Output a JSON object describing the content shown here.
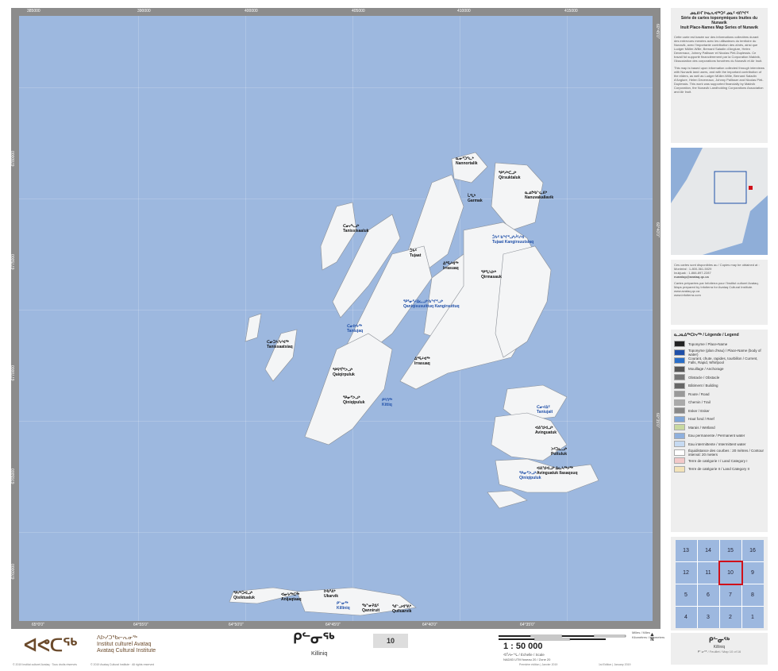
{
  "map": {
    "coords_top": [
      "385000",
      "390000",
      "400000",
      "405000",
      "410000",
      "415000"
    ],
    "coords_bottom": [
      "65°0'0\"",
      "64°55'0\"",
      "64°50'0\"",
      "64°45'0\"",
      "64°40'0\"",
      "64°35'0\""
    ],
    "coords_left": [
      "6780000",
      "6775000",
      "6770000",
      "6765000",
      "6760000"
    ],
    "coords_right": [
      "60°45'0\"",
      "60°40'0\"",
      "60°35'0\""
    ],
    "labels": [
      {
        "syll": "ᓇᓂᕐᑐᕐᓚᒃ",
        "name": "Nannortalik",
        "water": false
      },
      {
        "syll": "ᕿᕐᓱᒃᑕᓗᒃ",
        "name": "Qirsuktaluk",
        "water": false
      },
      {
        "syll": "ᒑᕐᒪᒃ",
        "name": "Garmak",
        "water": false
      },
      {
        "syll": "ᓇᓄᕗᑲᓪᓚᕕᒃ",
        "name": "Nanuvakallavik",
        "water": false
      },
      {
        "syll": "ᑕᓂᓯᓴᓗᒃ",
        "name": "Tanissisaaluk",
        "water": false
      },
      {
        "syll": "ᑑᔭᑦ",
        "name": "Tujaat",
        "water": false
      },
      {
        "syll": "ᑑᔭᑦ ᑲᖏᕐᓗᒃᓲᑦᓯᐊ",
        "name": "Tujaat Kangirsuutsiaq",
        "water": true
      },
      {
        "syll": "ᐃᕐᕋᓱᐊᖅ",
        "name": "Irrasuaq",
        "water": false
      },
      {
        "syll": "ᕿᕐᒪᓴᐅᒃ",
        "name": "Qirmasauk",
        "water": false
      },
      {
        "syll": "ᕿᕐᓂᕐᓱᐃᓚᓗᒃ ᑲᖏᕐᓗᒃ",
        "name": "Qaniqisusuittuq Kangirsuttuq",
        "water": true
      },
      {
        "syll": "ᑕᓂᐅᔭᖅ",
        "name": "Taniujaq",
        "water": true
      },
      {
        "syll": "ᑕᓂᑐᓴᑦᓯᐊᖅ",
        "name": "Tanissaatsiaq",
        "water": false
      },
      {
        "syll": "ᐃᕐᕋᓱᐊᖅ",
        "name": "Irrasuaq",
        "water": false
      },
      {
        "syll": "ᕿᕋᕐᒦᕐᐳᓗᒃ",
        "name": "Qaiqirpuluk",
        "water": false
      },
      {
        "syll": "ᕿᓂᕐᐳᓗᒃ",
        "name": "Qiniqipuluk",
        "water": false
      },
      {
        "syll": "ᑭᑦᑎᖅ",
        "name": "Kittiq",
        "water": true
      },
      {
        "syll": "ᑕᓂᔪᐃᑦ",
        "name": "Taniujait",
        "water": true
      },
      {
        "syll": "ᐊᕕᖑᐊᓗᒃ",
        "name": "Avinguatuk",
        "water": false
      },
      {
        "syll": "ᐳᑦᑐᓚᓗᒃ",
        "name": "Puttuluk",
        "water": false
      },
      {
        "syll": "ᐊᕕᖑᐊᓗᒃ ᐃᓚᓴᖅᓱᖅ",
        "name": "Avinguatuk Ilasaqsuq",
        "water": false
      },
      {
        "syll": "ᕿᓂᕐᐳᓗᒃ",
        "name": "Qiniqipuluk",
        "water": true
      },
      {
        "syll": "ᕿᓯᒃᑐᐊᓗᒃ",
        "name": "Qisiktualuk",
        "water": false
      },
      {
        "syll": "ᐊᓂᔭᖅᑕᖅ",
        "name": "Anijaqtaaq",
        "water": false
      },
      {
        "syll": "ᐅᑲᕐᕕᒃ",
        "name": "Ukarvik",
        "water": false
      },
      {
        "syll": "ᑭᓪᓂᖅ",
        "name": "Killiniq",
        "water": true
      },
      {
        "syll": "ᖃᓐᓂᕈᐃᑦ",
        "name": "Qanniruit",
        "water": false
      },
      {
        "syll": "ᖁᓪᓗᐊᕐᕕᒃ",
        "name": "Qulluarvik",
        "water": false
      }
    ]
  },
  "side": {
    "title_syll": "ᓄᓇᕕᒻᒥ ᐅᓇᕆᐊᖅᑐᑦ ᓄᓇᑦ ᐊᑎᖏᑦ",
    "title_fr": "Série de cartes toponymiques Inuites du Nunavik",
    "title_en": "Inuit Place-Names Map Series of Nunavik",
    "text_fr": "Cette carte est basée sur des informations collectées durant des entrevues menées avec les utilisateurs du territoire du Nunavik, avec l'importante contribution des aînés, ainsi que Ludger Müller-Wille, Bernard Saladin d'Anglure, Helen Devereaux, Johnny Pallisser et Nicolas Pirti-Duplessis. Ce travail fut supporté financièrement par la Corporation Makivik, l'Association des corporations foncières du Nunavik et Air Inuit.",
    "text_en": "This map is based upon information collected through interviews with Nunavik land users, and with the important contribution of the elders, as well as Ludger Müller-Wille, Bernard Saladin d'Anglure, Helen Devereaux, Johnny Pallisser and Nicolas Pirti-Duplessis. This work was supported financially by Makivik Corporation, the Nunavik Landholding Corporations Association and Air Inuit.",
    "copies_text": "Ces cartes sont disponibles au / Copies may be obtained at :",
    "montreal": "Montréal : 1-800-361-5029",
    "inukjuak": "Inukjuak : 1-866-897-2287",
    "email": "nunatop@avataq.qc.ca",
    "prepared": "Cartes préparées par Infotierra pour l'Institut culturel Avataq. Maps prepared by Infotierra for Avataq Cultural Institute.",
    "web1": "www.avataq.qc.ca",
    "web2": "www.infotierra.com",
    "legend_title": "ᓇᓗᓇᐃᖅᑕᐅᓯᖅ / Légende / Legend",
    "legend": [
      {
        "label": "Toponyme / Place-Name",
        "color": "#222222"
      },
      {
        "label": "Toponyme (plan d'eau) / Place-Name (body of water)",
        "color": "#1f4fa8"
      },
      {
        "label": "Courant, chute, rapides, tourbillon / Current, Falls, Rapid, Whirlpool",
        "color": "#2a6fc9"
      },
      {
        "label": "Mouillage / Anchorage",
        "color": "#555555"
      },
      {
        "label": "Obstacle / Obstacle",
        "color": "#777777"
      },
      {
        "label": "Bâtiment / Building",
        "color": "#666666"
      },
      {
        "label": "Route / Road",
        "color": "#999999"
      },
      {
        "label": "Chemin / Trail",
        "color": "#aaaaaa"
      },
      {
        "label": "Esker / Esker",
        "color": "#888888"
      },
      {
        "label": "Haut fond / Reef",
        "color": "#7fa6d8"
      },
      {
        "label": "Marais / Wetland",
        "color": "#c8d9a0"
      },
      {
        "label": "Eau permanente / Permanent water",
        "color": "#8fb0dd"
      },
      {
        "label": "Eau intermittente / Intermittent water",
        "color": "#c6daf2"
      },
      {
        "label": "Équidistance des courbes : 20 mètres / Contour interval: 20 meters",
        "color": "#ffffff"
      },
      {
        "label": "Terre de catégorie I / Land Category I",
        "color": "#f3c9c9"
      },
      {
        "label": "Terre de catégorie II / Land Category II",
        "color": "#f3e3b8"
      }
    ],
    "index_cells": [
      "13",
      "14",
      "15",
      "16",
      "12",
      "11",
      "10",
      "9",
      "5",
      "6",
      "7",
      "8",
      "4",
      "3",
      "2",
      "1"
    ],
    "selected_cell": "10",
    "sheet_syll": "ᑭᓪᓂᖅ",
    "sheet_name": "Killiniq",
    "sheet_caption": "ᑭᓪᓂᖅ / Feuillet / Map 10 of 16"
  },
  "footer": {
    "org_syll": "ᐊᕙᑕᖅ",
    "org_syll2": "ᐱᐅᓯᑐᖃᓕᕆᓂᖅ",
    "org_fr": "Institut culturel Avataq",
    "org_en": "Avataq Cultural Institute",
    "map_syll": "ᑭᓪᓂᖅ",
    "map_name": "Killiniq",
    "map_number": "10",
    "scale": "1 : 50 000",
    "scale_caption": "ᐊᒥᓱᓕᖓ / Échelle / Scale",
    "projection": "NAD83 UTM fuseau 20 / Zone 20",
    "miles_label": "Milles / Miles",
    "km_label": "Kilomètres / Kilometers",
    "north": "N",
    "copyright_left": "© 2019 Institut culturel Avataq · Tous droits réservés",
    "copyright_mid": "© 2019 Avataq Cultural Institute · All rights reserved",
    "edition_fr": "Première édition | Janvier 2019",
    "edition_en": "1st Edition | January 2019"
  }
}
